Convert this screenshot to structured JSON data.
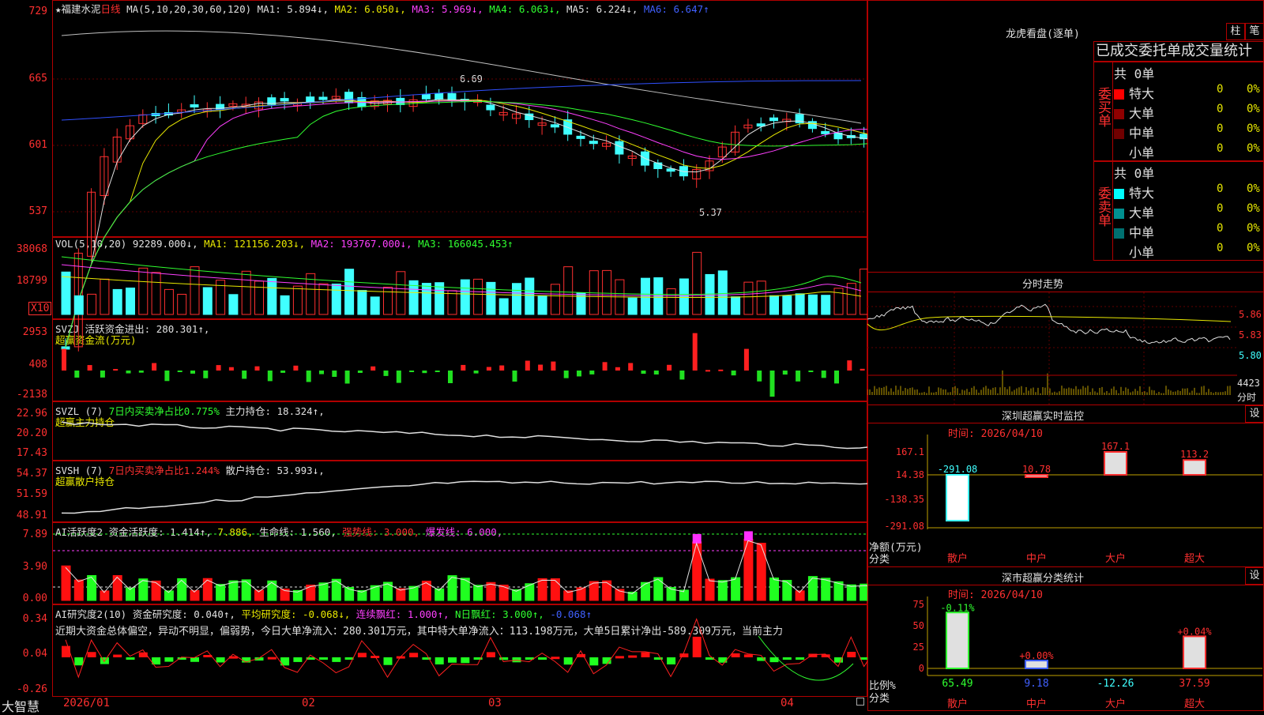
{
  "stock": {
    "name": "★福建水泥",
    "period": "日线"
  },
  "kline": {
    "ma_header": "MA(5,10,20,30,60,120)",
    "ma1": "MA1: 5.894↓,",
    "ma2": "MA2: 6.050↓,",
    "ma3": "MA3: 5.969↓,",
    "ma4": "MA4: 6.063↓,",
    "ma5": "MA5: 6.224↓,",
    "ma6": "MA6: 6.647↑",
    "y_labels": [
      "729",
      "665",
      "601",
      "537"
    ],
    "high_label": "6.69",
    "low_label": "5.37"
  },
  "vol": {
    "header": "VOL(5,10,20)",
    "value": "92289.000↓,",
    "ma1": "MA1: 121156.203↓,",
    "ma2": "MA2: 193767.000↓,",
    "ma3": "MA3: 166045.453↑",
    "y_labels": [
      "38068",
      "18799"
    ],
    "unit": "X10"
  },
  "svzj": {
    "header": "SVZJ",
    "text1": "活跃资金进出: 280.301↑,",
    "text2": "超赢资金流(万元)",
    "y_labels": [
      "2953",
      "408",
      "-2138"
    ]
  },
  "svzl": {
    "header": "SVZL (7)",
    "text1": "7日内买卖净占比0.775%",
    "text2": "主力持仓: 18.324↑,",
    "text3": "超赢主力持仓",
    "y_labels": [
      "22.96",
      "20.20",
      "17.43"
    ]
  },
  "svsh": {
    "header": "SVSH (7)",
    "text1": "7日内买卖净占比1.244%",
    "text2": "散户持仓: 53.993↓,",
    "text3": "超赢散户持仓",
    "y_labels": [
      "54.37",
      "51.59",
      "48.91"
    ]
  },
  "ai1": {
    "header": "AI活跃度2",
    "t1": "资金活跃度: 1.414↑,",
    "t2": "7.886,",
    "t3": "生命线: 1.560,",
    "t4": "强势线: 3.000,",
    "t5": "爆发线: 6.000,",
    "y_labels": [
      "7.89",
      "3.90",
      "0.00"
    ]
  },
  "ai2": {
    "header": "AI研究度2(10)",
    "t1": "资金研究度: 0.040↑,",
    "t2": "平均研究度: -0.068↓,",
    "t3": "连续飘红: 1.000↑,",
    "t4": "N日飘红: 3.000↑,",
    "t5": "-0.068↑",
    "comment": "近期大资金总体偏空，异动不明显，偏弱势，今日大单净流入：280.301万元，其中特大单净流入：113.198万元，大单5日累计净出-589.309万元，当前主力",
    "y_labels": [
      "0.34",
      "0.04",
      "-0.26"
    ]
  },
  "xaxis": {
    "logo": "大智慧",
    "labels": [
      "2026/01",
      "02",
      "03",
      "04"
    ]
  },
  "lhb": {
    "title": "龙虎看盘(逐单)",
    "btn1": "柱",
    "btn2": "笔",
    "subtitle": "已成交委托单成交量统计",
    "buy_label": "委买单",
    "sell_label": "委卖单",
    "buy_total": "共 0单",
    "sell_total": "共 0单",
    "buy_rows": [
      {
        "name": "特大",
        "vol": "0",
        "pct": "0%",
        "color": "#ff0000"
      },
      {
        "name": "大单",
        "vol": "0",
        "pct": "0%",
        "color": "#900000"
      },
      {
        "name": "中单",
        "vol": "0",
        "pct": "0%",
        "color": "#700000"
      },
      {
        "name": "小单",
        "vol": "0",
        "pct": "0%",
        "color": ""
      }
    ],
    "sell_rows": [
      {
        "name": "特大",
        "vol": "0",
        "pct": "0%",
        "color": "#00ffff"
      },
      {
        "name": "大单",
        "vol": "0",
        "pct": "0%",
        "color": "#009090"
      },
      {
        "name": "中单",
        "vol": "0",
        "pct": "0%",
        "color": "#007070"
      },
      {
        "name": "小单",
        "vol": "0",
        "pct": "0%",
        "color": ""
      }
    ]
  },
  "intraday": {
    "title": "分时走势",
    "y_labels": [
      "5.86",
      "5.83",
      "5.80"
    ],
    "vol_label": "4423",
    "vol_unit": "分时"
  },
  "monitor": {
    "title": "深圳超赢实时监控",
    "btn": "设",
    "date": "时间: 2026/04/10",
    "y_labels": [
      "167.1",
      "14.38",
      "-138.35",
      "-291.08"
    ],
    "unit1": "净额(万元)",
    "unit2": "分类",
    "cats": [
      "散户",
      "中户",
      "大户",
      "超大"
    ],
    "values": [
      "-291.08",
      "10.78",
      "167.1",
      "113.2"
    ]
  },
  "classify": {
    "title": "深市超赢分类统计",
    "btn": "设",
    "date": "时间: 2026/04/10",
    "y_labels": [
      "75",
      "50",
      "25",
      "0"
    ],
    "unit1": "比例%",
    "unit2": "分类",
    "cats": [
      "散户",
      "中户",
      "大户",
      "超大"
    ],
    "top": [
      "-0.11%",
      "+0.00%",
      "",
      "+0.04%"
    ],
    "bottom": [
      "65.49",
      "9.18",
      "-12.26",
      "37.59"
    ]
  }
}
